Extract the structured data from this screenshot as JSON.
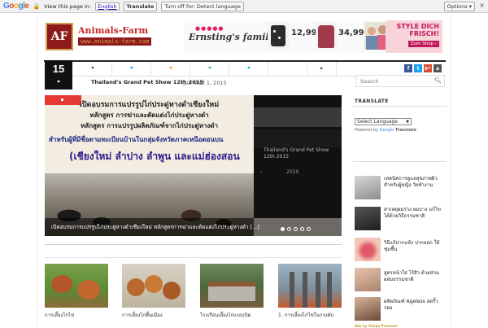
{
  "google_bar": {
    "logo": "Google",
    "view_text": "View this page in:",
    "language": "English",
    "translate_label": "Translate",
    "turn_off_label": "Turn off for: Detect language",
    "options_label": "Options ▾",
    "close_glyph": "×"
  },
  "header": {
    "logo_mark": "AF",
    "logo_title": "Animals-Farm",
    "logo_url": "www.animals-farm.com"
  },
  "ad": {
    "brand": "Ernsting's family",
    "price1": "12,99",
    "price2": "34,99",
    "promo": "STYLE DICH FRISCH!",
    "cta": "Zum Shop ›"
  },
  "nav": {
    "date_day": "15",
    "social": [
      "f",
      "t",
      "g+",
      "a"
    ],
    "colors": {
      "facebook": "#3b5998",
      "twitter": "#1da1f2",
      "gplus": "#dd4b39",
      "other": "#555555"
    }
  },
  "ticker": {
    "headline": "Thailand's Grand Pet Show 12th 2015",
    "date": "กุมภาพันธ์ 1, 2015"
  },
  "search": {
    "placeholder": "Search"
  },
  "slider": {
    "line1": "เปิดอบรมการแปรรูปไก่ประดู่หางดำเชียงใหม่",
    "line2": "หลักสูตร การฆ่าและตัดแต่งไก่ประดู่หางดำ",
    "line3": "หลักสูตร การแปรรูปผลิตภัณฑ์จากไก่ประดู่หางดำ",
    "line4": "สำหรับผู้ที่มีชื่อตามทะเบียนบ้านในกลุ่มจังหวัดภาคเหนือตอนบน",
    "line5": "(เชียงใหม่ ลำปาง ลำพูน และแม่ฮ่องสอน",
    "caption": "เปิดอบรมการแปรรูปไก่ประดู่หางดำเชียงใหม่ หลักสูตรการฆ่าและตัดแต่งไก่ประดู่หางดำ [...]",
    "side_title": "Thailand's Grand Pet Show 12th 2015",
    "side_num": "2559",
    "side_arrow": "»"
  },
  "posts": [
    {
      "title": "การเลี้ยงไก่ไข่"
    },
    {
      "title": "การเลี้ยงไก่พื้นเมือง"
    },
    {
      "title": "โรงเรือนเลี้ยงไก่แบบเปิด"
    },
    {
      "title": "1. การเลี้ยงไก่ไข่ในกรงตับ"
    }
  ],
  "sidebar": {
    "translate_heading": "TRANSLATE",
    "select_language": "Select Language",
    "powered_by": "Powered by",
    "google": "Google",
    "translate": "Translate",
    "popular": [
      "เทคนิคการดูแลสุขภาพผิว สำหรับผู้หญิง วัยทำงาน",
      "สาเหตุผมร่วง ผมบาง แก้ไขได้ด้วยวิธีธรรมชาติ",
      "วิธีแก้ปากแห้ง ปากลอก ให้ชุ่มชื้น",
      "สูตรหน้าใส ไร้สิว ด้วยส่วนผสมธรรมชาติ",
      "ผลิตภัณฑ์ Ageless ลดริ้วรอย"
    ],
    "credit": "Ads by Tempo Premium"
  }
}
